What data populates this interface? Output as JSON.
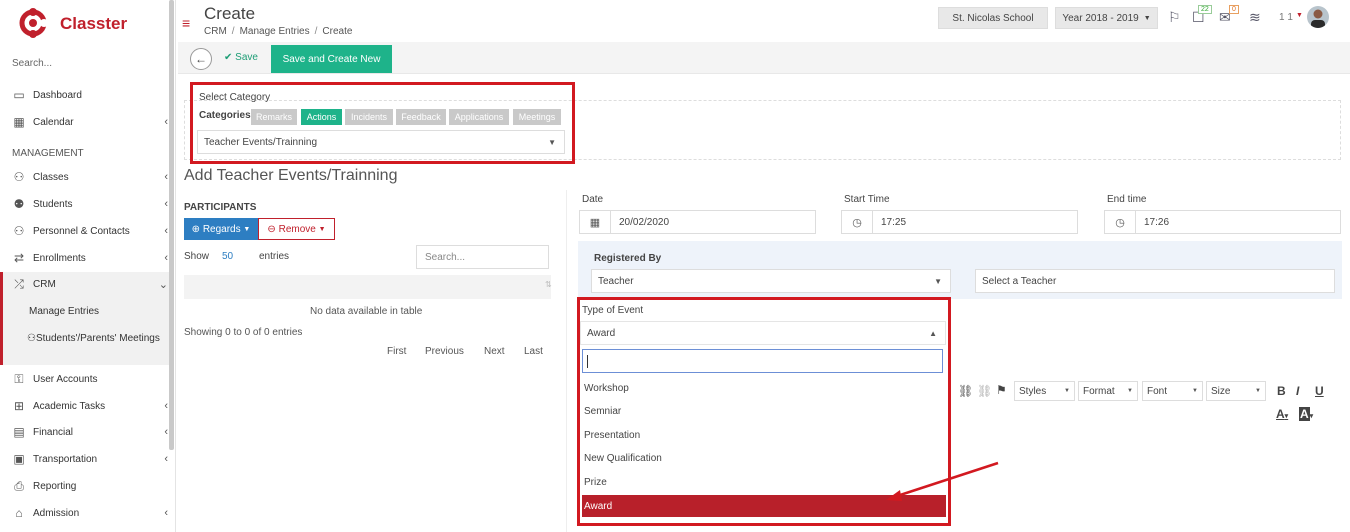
{
  "brand": {
    "name": "Classter"
  },
  "sidebar": {
    "search_placeholder": "Search...",
    "management_header": "MANAGEMENT",
    "items": [
      {
        "label": "Dashboard",
        "icon": "laptop-icon"
      },
      {
        "label": "Calendar",
        "icon": "calendar-icon"
      },
      {
        "label": "Classes",
        "icon": "classes-icon"
      },
      {
        "label": "Students",
        "icon": "students-icon"
      },
      {
        "label": "Personnel & Contacts",
        "icon": "contacts-icon"
      },
      {
        "label": "Enrollments",
        "icon": "exchange-icon"
      },
      {
        "label": "CRM",
        "icon": "shuffle-icon"
      },
      {
        "label": "User Accounts",
        "icon": "key-icon"
      },
      {
        "label": "Academic Tasks",
        "icon": "grid-icon"
      },
      {
        "label": "Financial",
        "icon": "money-icon"
      },
      {
        "label": "Transportation",
        "icon": "bus-icon"
      },
      {
        "label": "Reporting",
        "icon": "print-icon"
      },
      {
        "label": "Admission",
        "icon": "bank-icon"
      }
    ],
    "crm_sub": {
      "manage_entries": "Manage Entries",
      "meetings": "Students'/Parents' Meetings"
    }
  },
  "header": {
    "title": "Create",
    "breadcrumb": [
      "CRM",
      "Manage Entries",
      "Create"
    ],
    "school": "St. Nicolas School",
    "year": "Year 2018 - 2019",
    "notifications_count": "22",
    "messages_count": "0",
    "user_label": "1 1"
  },
  "toolbar": {
    "save_label": "Save",
    "save_new_label": "Save and Create New"
  },
  "category": {
    "section_label": "Select Category",
    "categories_label": "Categories",
    "tabs": [
      "Remarks",
      "Actions",
      "Incidents",
      "Feedback",
      "Applications",
      "Meetings"
    ],
    "active_tab": "Actions",
    "selected": "Teacher Events/Trainning"
  },
  "form": {
    "title": "Add Teacher Events/Trainning",
    "participants": {
      "label": "PARTICIPANTS",
      "regards_btn": "Regards",
      "remove_btn": "Remove",
      "show_label": "Show",
      "show_count": "50",
      "entries_label": "entries",
      "search_placeholder": "Search...",
      "empty_text": "No data available in table",
      "info": "Showing 0 to 0 of 0 entries",
      "pager": [
        "First",
        "Previous",
        "Next",
        "Last"
      ]
    },
    "date": {
      "label": "Date",
      "value": "20/02/2020"
    },
    "start_time": {
      "label": "Start Time",
      "value": "17:25"
    },
    "end_time": {
      "label": "End time",
      "value": "17:26"
    },
    "registered_by": {
      "label": "Registered By",
      "type": "Teacher",
      "placeholder": "Select a Teacher"
    },
    "type_of_event": {
      "label": "Type of Event",
      "value": "Award",
      "options": [
        "Workshop",
        "Semniar",
        "Presentation",
        "New Qualification",
        "Prize",
        "Award"
      ],
      "highlighted": "Award"
    },
    "editor": {
      "styles": "Styles",
      "format": "Format",
      "font": "Font",
      "size": "Size",
      "bold": "B",
      "italic": "I",
      "underline": "U",
      "text_color": "A",
      "bg_color": "A"
    }
  },
  "colors": {
    "brand_red": "#c0202c",
    "green": "#1eb38a",
    "blue": "#2d7ec2",
    "highlight_red": "#d21920"
  }
}
